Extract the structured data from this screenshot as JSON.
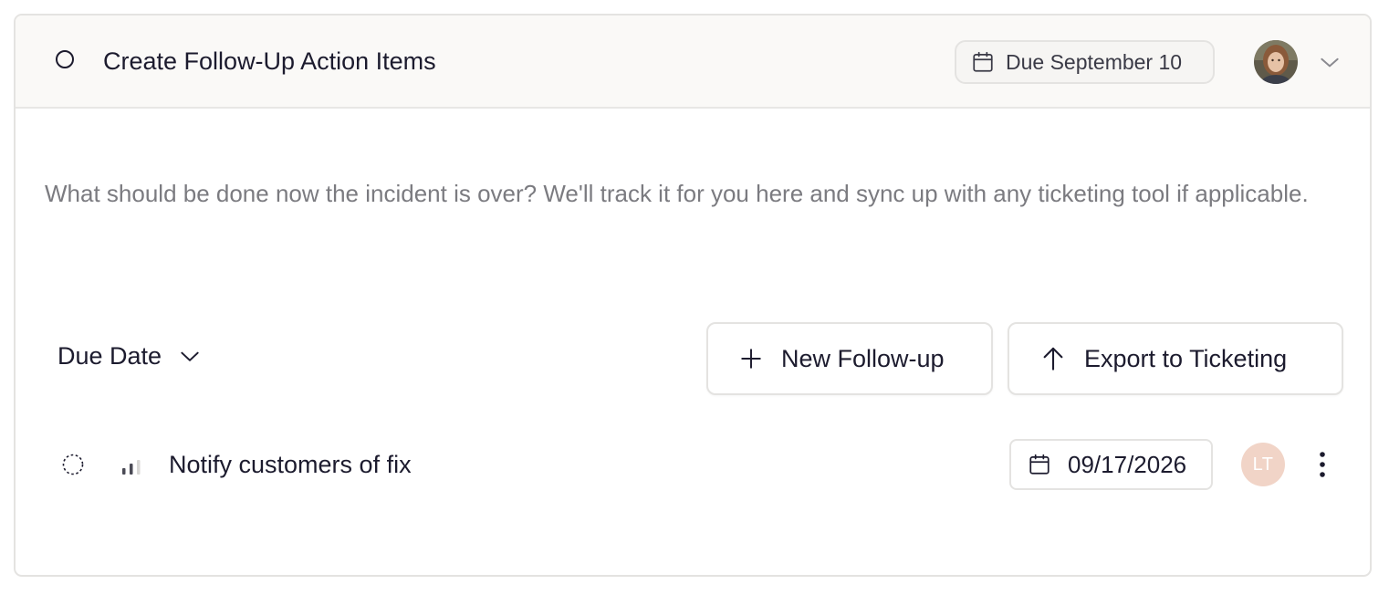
{
  "task": {
    "title": "Create Follow-Up Action Items",
    "due_label": "Due September 10",
    "status_icon": "circle-outline-icon",
    "assignee_avatar": "user-photo-avatar"
  },
  "description": "What should be done now the incident is over? We'll track it for you here and sync up with any ticketing tool if applicable.",
  "toolbar": {
    "sort_label": "Due Date",
    "new_followup_label": "New Follow-up",
    "export_label": "Export to Ticketing"
  },
  "followups": [
    {
      "title": "Notify customers of fix",
      "due_date": "09/17/2026",
      "assignee_initials": "LT",
      "status_icon": "dashed-circle-icon",
      "priority_icon": "priority-bars-icon"
    }
  ],
  "colors": {
    "text": "#1c1b2e",
    "muted_text": "#7b7b80",
    "border": "#e4e3e1",
    "header_bg": "#faf9f7",
    "assignee_avatar_bg": "#f1d4c7"
  }
}
